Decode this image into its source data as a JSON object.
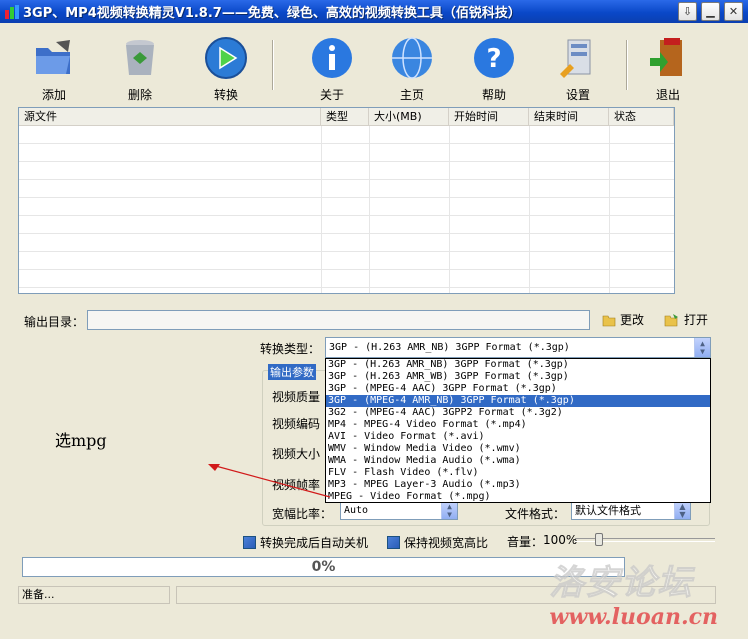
{
  "window": {
    "title": "3GP、MP4视频转换精灵V1.8.7——免费、绿色、高效的视频转换工具（佰锐科技）"
  },
  "toolbar": {
    "add": "添加",
    "delete": "删除",
    "convert": "转换",
    "about": "关于",
    "home": "主页",
    "help": "帮助",
    "settings": "设置",
    "exit": "退出"
  },
  "filelist": {
    "columns": [
      "源文件",
      "类型",
      "大小(MB)",
      "开始时间",
      "结束时间",
      "状态"
    ]
  },
  "output": {
    "dir_label": "输出目录：",
    "dir_value": "",
    "change_label": "更改",
    "open_label": "打开"
  },
  "convert": {
    "type_label": "转换类型：",
    "type_value": "3GP - (H.263 AMR_NB) 3GPP Format (*.3gp)",
    "options": [
      "3GP - (H.263 AMR_NB) 3GPP Format (*.3gp)",
      "3GP - (H.263 AMR_WB) 3GPP Format (*.3gp)",
      "3GP - (MPEG-4 AAC) 3GPP Format (*.3gp)",
      "3GP - (MPEG-4 AMR_NB) 3GPP Format (*.3gp)",
      "3G2 - (MPEG-4 AAC) 3GPP2 Format (*.3g2)",
      "MP4 - MPEG-4 Video Format (*.mp4)",
      "AVI - Video Format (*.avi)",
      "WMV - Window Media Video (*.wmv)",
      "WMA - Window Media Audio (*.wma)",
      "FLV - Flash Video (*.flv)",
      "MP3 - MPEG Layer-3 Audio (*.mp3)",
      "MPEG - Video Format (*.mpg)"
    ],
    "highlighted_index": 3
  },
  "params": {
    "group_title": "输出参数",
    "quality_label": "视频质量",
    "encoder_label": "视频编码",
    "size_label": "视频大小",
    "fps_label": "视频帧率",
    "aspect_label": "宽幅比率：",
    "aspect_value": "Auto",
    "format_label": "文件格式：",
    "format_value": "默认文件格式"
  },
  "options": {
    "autoshutdown_label": "转换完成后自动关机",
    "keepaspect_label": "保持视频宽高比",
    "volume_label": "音量：",
    "volume_value": "100%",
    "volume_level": 1.0
  },
  "progress": {
    "text": "0%",
    "value": 0
  },
  "status": {
    "text": "准备..."
  },
  "annotation": {
    "text": "选mpg"
  },
  "watermark": {
    "logo_text": "洛安论坛",
    "url": "www.luoan.cn"
  },
  "colors": {
    "titlebar": "#0a48c8",
    "highlight": "#316ac5",
    "arrow": "#d11a1a"
  }
}
